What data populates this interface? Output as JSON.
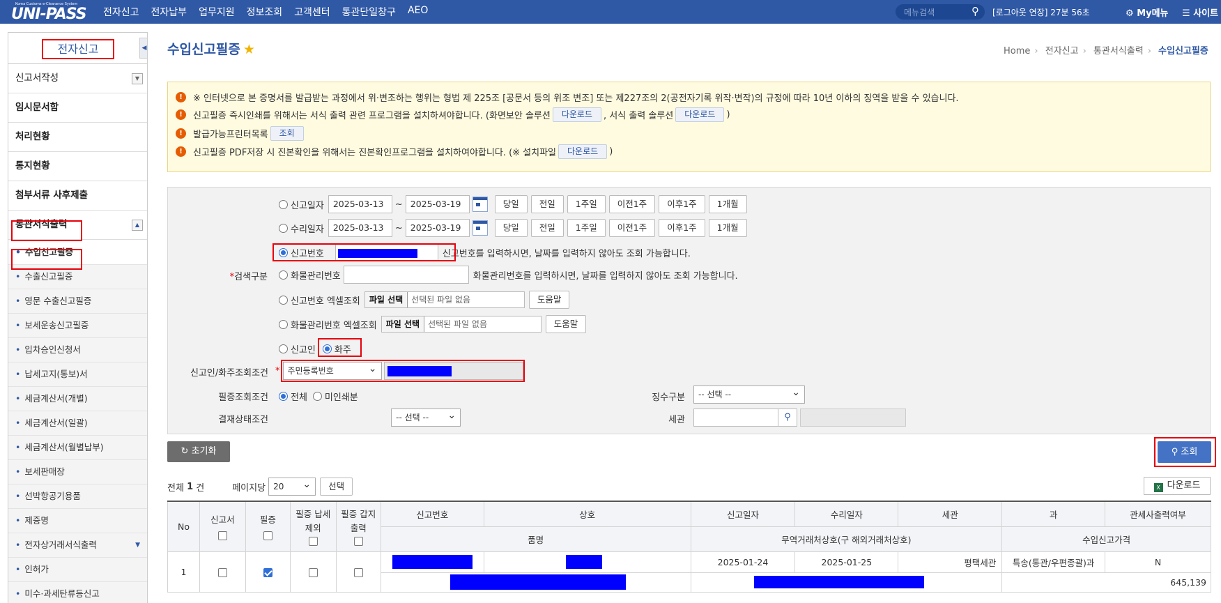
{
  "topbar": {
    "logo_small": "Korea Customs e-Clearance System",
    "logo_text": "UNI-PASS",
    "nav": [
      "전자신고",
      "전자납부",
      "업무지원",
      "정보조회",
      "고객센터",
      "통관단일창구",
      "AEO"
    ],
    "search_placeholder": "메뉴검색",
    "session": "[로그아웃 연장] 27분 56초",
    "mymenu": "My메뉴",
    "site": "사이트"
  },
  "sidebar": {
    "title": "전자신고",
    "toggle_icon": "chevron-left-icon",
    "items": [
      {
        "label": "신고서작성",
        "bold": false,
        "expand": "chevron-down-icon"
      },
      {
        "label": "임시문서함",
        "bold": true
      },
      {
        "label": "처리현황",
        "bold": true
      },
      {
        "label": "통지현황",
        "bold": true
      },
      {
        "label": "첨부서류 사후제출",
        "bold": true
      },
      {
        "label": "통관서식출력",
        "bold": true,
        "expand": "chevron-up-icon"
      }
    ],
    "subitems": [
      "수입신고필증",
      "수출신고필증",
      "영문 수출신고필증",
      "보세운송신고필증",
      "입차승인신청서",
      "납세고지(통보)서",
      "세금계산서(개별)",
      "세금계산서(일괄)",
      "세금계산서(월별납부)",
      "보세판매장",
      "선박항공기용품",
      "제증명",
      "전자상거래서식출력",
      "인허가",
      "미수·과세탄류등신고"
    ]
  },
  "page": {
    "title": "수입신고필증",
    "breadcrumb": [
      "Home",
      "전자신고",
      "통관서식출력",
      "수입신고필증"
    ]
  },
  "notice": {
    "line1": "※ 인터넷으로 본 증명서를 발급받는 과정에서 위·변조하는 행위는 형법 제 225조 [공문서 등의 위조 변조] 또는 제227조의 2(공전자기록 위작·변작)의 규정에 따라 10년 이하의 징역을 받을 수 있습니다.",
    "line2_a": "신고필증 즉시인쇄를 위해서는 서식 출력 관련 프로그램을 설치하셔야합니다. (화면보안 솔루션",
    "line2_btn1": "다운로드",
    "line2_b": ", 서식 출력 솔루션",
    "line2_btn2": "다운로드",
    "line2_c": ")",
    "line3_a": "발급가능프린터목록",
    "line3_btn": "조회",
    "line4_a": "신고필증 PDF저장 시 진본확인을 위해서는 진본확인프로그램을 설치하여야합니다. (※ 설치파일",
    "line4_btn": "다운로드",
    "line4_c": ")"
  },
  "form": {
    "search_type_label": "검색구분",
    "req_mark": "*",
    "row1": {
      "label": "신고일자",
      "from": "2025-03-13",
      "to": "2025-03-19"
    },
    "row2": {
      "label": "수리일자",
      "from": "2025-03-13",
      "to": "2025-03-19"
    },
    "tilde": "~",
    "date_buttons": [
      "당일",
      "전일",
      "1주일",
      "이전1주",
      "이후1주",
      "1개월"
    ],
    "row3": {
      "label": "신고번호",
      "hint": "신고번호를 입력하시면, 날짜를 입력하지 않아도 조회 가능합니다."
    },
    "row4": {
      "label": "화물관리번호",
      "hint": "화물관리번호를 입력하시면, 날짜를 입력하지 않아도 조회 가능합니다."
    },
    "row5": {
      "label": "신고번호 엑셀조회",
      "file_btn": "파일 선택",
      "file_text": "선택된 파일 없음",
      "help": "도움말"
    },
    "row6": {
      "label": "화물관리번호 엑셀조회",
      "file_btn": "파일 선택",
      "file_text": "선택된 파일 없음",
      "help": "도움말"
    },
    "row7": {
      "opt1": "신고인",
      "opt2": "화주"
    },
    "cond_label": "신고인/화주조회조건",
    "cond_select": "주민등록번호",
    "print_cond_label": "필증조회조건",
    "print_opt1": "전체",
    "print_opt2": "미인쇄분",
    "collect_label": "징수구분",
    "collect_select": "-- 선택 --",
    "pay_label": "결재상태조건",
    "pay_select": "-- 선택 --",
    "customs_label": "세관"
  },
  "actions": {
    "reset": "초기화",
    "search": "조회"
  },
  "list": {
    "total_prefix": "전체",
    "total_count": "1",
    "total_suffix": "건",
    "per_page_label": "페이지당",
    "per_page": "20",
    "select_btn": "선택",
    "download": "다운로드"
  },
  "table": {
    "h": {
      "no": "No",
      "report": "신고서",
      "cert": "필증",
      "cert_tax": "필증 납세제외",
      "cert_sheet": "필증 갑지출력",
      "report_no": "신고번호",
      "company": "상호",
      "report_date": "신고일자",
      "accept_date": "수리일자",
      "customs": "세관",
      "dept": "과",
      "broker_print": "관세사출력여부",
      "item": "품명",
      "trader": "무역거래처상호(구 해외거래처상호)",
      "price": "수입신고가격"
    },
    "rows": [
      {
        "no": "1",
        "report_date": "2025-01-24",
        "accept_date": "2025-01-25",
        "customs": "평택세관",
        "dept": "특송(통관/우편종괄)과",
        "broker_print": "N",
        "price": "645,139",
        "cert_checked": true
      }
    ]
  }
}
